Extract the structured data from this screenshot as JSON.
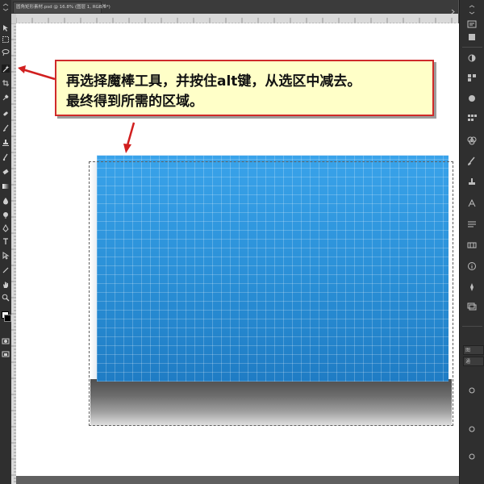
{
  "document": {
    "tab_title": "圆角矩形素材.psd @ 16.8% (图层 1, RGB/8*)",
    "tab_close": "×"
  },
  "callout": {
    "line1": "再选择魔棒工具，并按住alt键，从选区中减去。",
    "line2": "最终得到所需的区域。"
  },
  "right_panel": {
    "tabs": [
      "图",
      "通"
    ]
  },
  "colors": {
    "callout_bg": "#ffffc8",
    "callout_border": "#cf2a2a",
    "arrow": "#d11f1f",
    "panel_blue": "#2a8fd6",
    "ui_dark": "#2f2f2f"
  },
  "icons": {
    "toolbar": [
      "move-icon",
      "marquee-icon",
      "lasso-icon",
      "magic-wand-icon",
      "crop-icon",
      "eyedropper-icon",
      "healing-icon",
      "brush-icon",
      "stamp-icon",
      "history-brush-icon",
      "eraser-icon",
      "gradient-icon",
      "blur-icon",
      "dodge-icon",
      "pen-icon",
      "type-icon",
      "path-select-icon",
      "shape-icon",
      "hand-icon",
      "zoom-icon"
    ],
    "right_panel": [
      "history-icon",
      "properties-icon",
      "adjustments-icon",
      "styles-icon",
      "color-icon",
      "swatches-icon",
      "channels-icon",
      "paragraph-icon"
    ]
  }
}
